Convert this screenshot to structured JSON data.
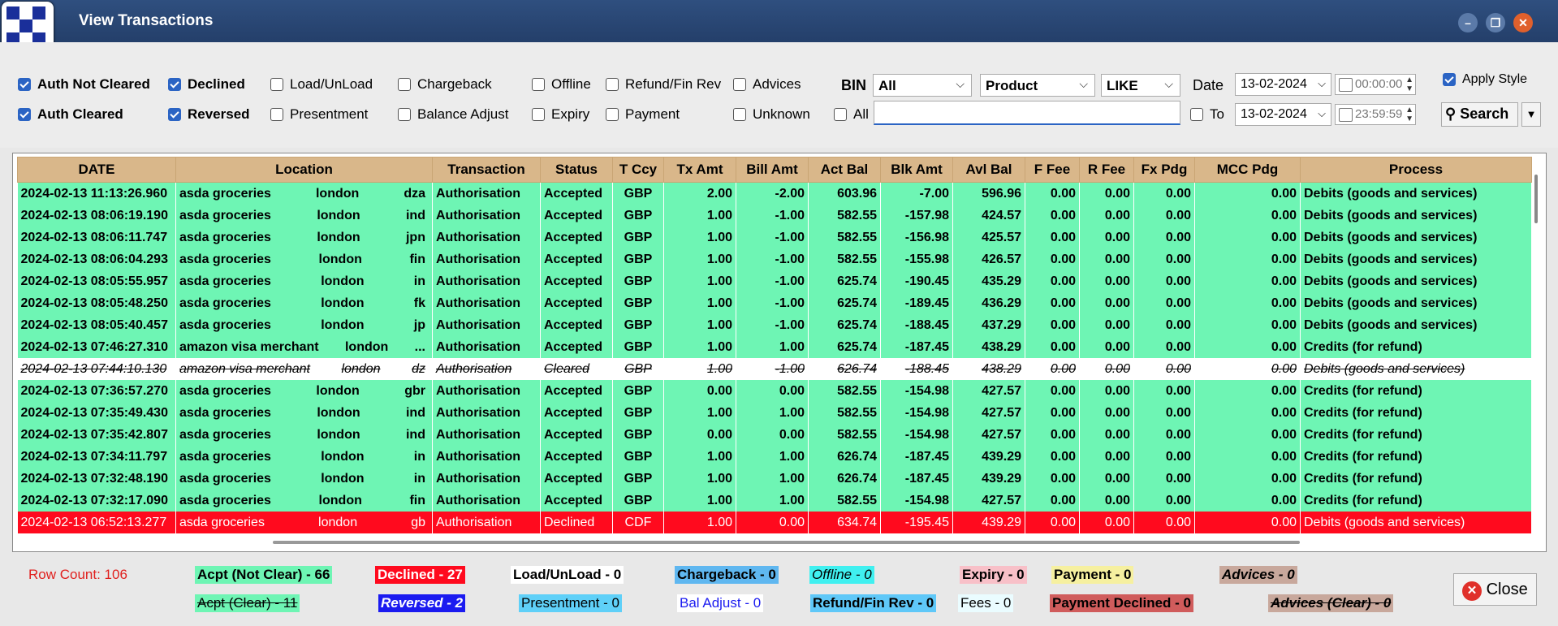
{
  "window": {
    "title": "View Transactions"
  },
  "filters": {
    "checkboxes": [
      {
        "label": "Auth Not Cleared",
        "checked": true
      },
      {
        "label": "Declined",
        "checked": true
      },
      {
        "label": "Load/UnLoad",
        "checked": false
      },
      {
        "label": "Chargeback",
        "checked": false
      },
      {
        "label": "Offline",
        "checked": false
      },
      {
        "label": "Refund/Fin Rev",
        "checked": false
      },
      {
        "label": "Advices",
        "checked": false
      },
      {
        "label": "Auth Cleared",
        "checked": true
      },
      {
        "label": "Reversed",
        "checked": true
      },
      {
        "label": "Presentment",
        "checked": false
      },
      {
        "label": "Balance Adjust",
        "checked": false
      },
      {
        "label": "Expiry",
        "checked": false
      },
      {
        "label": "Payment",
        "checked": false
      },
      {
        "label": "Unknown",
        "checked": false
      },
      {
        "label": "All",
        "checked": false
      },
      {
        "label": "To",
        "checked": false
      },
      {
        "label": "Apply Style",
        "checked": true
      }
    ],
    "bin_label": "BIN",
    "bin_select": "All",
    "product_select": "Product",
    "like_select": "LIKE",
    "date_label": "Date",
    "date_from": "13-02-2024",
    "time_from": "00:00:00",
    "date_to": "13-02-2024",
    "time_to": "23:59:59",
    "search_label": "Search"
  },
  "table": {
    "columns": [
      "DATE",
      "Location",
      "Transaction",
      "Status",
      "T Ccy",
      "Tx Amt",
      "Bill Amt",
      "Act Bal",
      "Blk Amt",
      "Avl Bal",
      "F Fee",
      "R Fee",
      "Fx Pdg",
      "MCC Pdg",
      "Process"
    ],
    "rows": [
      {
        "style": "green",
        "cells": [
          "2024-02-13 11:13:26.960",
          "asda groceries",
          "london",
          "dza",
          "Authorisation",
          "Accepted",
          "GBP",
          "2.00",
          "-2.00",
          "603.96",
          "-7.00",
          "596.96",
          "0.00",
          "0.00",
          "0.00",
          "0.00",
          "Debits (goods and services)"
        ]
      },
      {
        "style": "green",
        "cells": [
          "2024-02-13 08:06:19.190",
          "asda groceries",
          "london",
          "ind",
          "Authorisation",
          "Accepted",
          "GBP",
          "1.00",
          "-1.00",
          "582.55",
          "-157.98",
          "424.57",
          "0.00",
          "0.00",
          "0.00",
          "0.00",
          "Debits (goods and services)"
        ]
      },
      {
        "style": "green",
        "cells": [
          "2024-02-13 08:06:11.747",
          "asda groceries",
          "london",
          "jpn",
          "Authorisation",
          "Accepted",
          "GBP",
          "1.00",
          "-1.00",
          "582.55",
          "-156.98",
          "425.57",
          "0.00",
          "0.00",
          "0.00",
          "0.00",
          "Debits (goods and services)"
        ]
      },
      {
        "style": "green",
        "cells": [
          "2024-02-13 08:06:04.293",
          "asda groceries",
          "london",
          "fin",
          "Authorisation",
          "Accepted",
          "GBP",
          "1.00",
          "-1.00",
          "582.55",
          "-155.98",
          "426.57",
          "0.00",
          "0.00",
          "0.00",
          "0.00",
          "Debits (goods and services)"
        ]
      },
      {
        "style": "green",
        "cells": [
          "2024-02-13 08:05:55.957",
          "asda groceries",
          "london",
          "in",
          "Authorisation",
          "Accepted",
          "GBP",
          "1.00",
          "-1.00",
          "625.74",
          "-190.45",
          "435.29",
          "0.00",
          "0.00",
          "0.00",
          "0.00",
          "Debits (goods and services)"
        ]
      },
      {
        "style": "green",
        "cells": [
          "2024-02-13 08:05:48.250",
          "asda groceries",
          "london",
          "fk",
          "Authorisation",
          "Accepted",
          "GBP",
          "1.00",
          "-1.00",
          "625.74",
          "-189.45",
          "436.29",
          "0.00",
          "0.00",
          "0.00",
          "0.00",
          "Debits (goods and services)"
        ]
      },
      {
        "style": "green",
        "cells": [
          "2024-02-13 08:05:40.457",
          "asda groceries",
          "london",
          "jp",
          "Authorisation",
          "Accepted",
          "GBP",
          "1.00",
          "-1.00",
          "625.74",
          "-188.45",
          "437.29",
          "0.00",
          "0.00",
          "0.00",
          "0.00",
          "Debits (goods and services)"
        ]
      },
      {
        "style": "green",
        "cells": [
          "2024-02-13 07:46:27.310",
          "amazon visa merchant",
          "london",
          "...",
          "Authorisation",
          "Accepted",
          "GBP",
          "1.00",
          "1.00",
          "625.74",
          "-187.45",
          "438.29",
          "0.00",
          "0.00",
          "0.00",
          "0.00",
          "Credits (for refund)"
        ]
      },
      {
        "style": "strike",
        "cells": [
          "2024-02-13 07:44:10.130",
          "amazon visa merchant",
          "london",
          "dz",
          "Authorisation",
          "Cleared",
          "GBP",
          "1.00",
          "-1.00",
          "626.74",
          "-188.45",
          "438.29",
          "0.00",
          "0.00",
          "0.00",
          "0.00",
          "Debits (goods and services)"
        ]
      },
      {
        "style": "green",
        "cells": [
          "2024-02-13 07:36:57.270",
          "asda groceries",
          "london",
          "gbr",
          "Authorisation",
          "Accepted",
          "GBP",
          "0.00",
          "0.00",
          "582.55",
          "-154.98",
          "427.57",
          "0.00",
          "0.00",
          "0.00",
          "0.00",
          "Credits (for refund)"
        ]
      },
      {
        "style": "green",
        "cells": [
          "2024-02-13 07:35:49.430",
          "asda groceries",
          "london",
          "ind",
          "Authorisation",
          "Accepted",
          "GBP",
          "1.00",
          "1.00",
          "582.55",
          "-154.98",
          "427.57",
          "0.00",
          "0.00",
          "0.00",
          "0.00",
          "Credits (for refund)"
        ]
      },
      {
        "style": "green",
        "cells": [
          "2024-02-13 07:35:42.807",
          "asda groceries",
          "london",
          "ind",
          "Authorisation",
          "Accepted",
          "GBP",
          "0.00",
          "0.00",
          "582.55",
          "-154.98",
          "427.57",
          "0.00",
          "0.00",
          "0.00",
          "0.00",
          "Credits (for refund)"
        ]
      },
      {
        "style": "green",
        "cells": [
          "2024-02-13 07:34:11.797",
          "asda groceries",
          "london",
          "in",
          "Authorisation",
          "Accepted",
          "GBP",
          "1.00",
          "1.00",
          "626.74",
          "-187.45",
          "439.29",
          "0.00",
          "0.00",
          "0.00",
          "0.00",
          "Credits (for refund)"
        ]
      },
      {
        "style": "green",
        "cells": [
          "2024-02-13 07:32:48.190",
          "asda groceries",
          "london",
          "in",
          "Authorisation",
          "Accepted",
          "GBP",
          "1.00",
          "1.00",
          "626.74",
          "-187.45",
          "439.29",
          "0.00",
          "0.00",
          "0.00",
          "0.00",
          "Credits (for refund)"
        ]
      },
      {
        "style": "green",
        "cells": [
          "2024-02-13 07:32:17.090",
          "asda groceries",
          "london",
          "fin",
          "Authorisation",
          "Accepted",
          "GBP",
          "1.00",
          "1.00",
          "582.55",
          "-154.98",
          "427.57",
          "0.00",
          "0.00",
          "0.00",
          "0.00",
          "Credits (for refund)"
        ]
      },
      {
        "style": "red",
        "cells": [
          "2024-02-13 06:52:13.277",
          "asda groceries",
          "london",
          "gb",
          "Authorisation",
          "Declined",
          "CDF",
          "1.00",
          "0.00",
          "634.74",
          "-195.45",
          "439.29",
          "0.00",
          "0.00",
          "0.00",
          "0.00",
          "Debits (goods and services)"
        ]
      }
    ]
  },
  "footer": {
    "row_count": "Row Count: 106",
    "legend": [
      {
        "text": "Acpt (Not Clear) - 66",
        "bg": "#6ef5b4",
        "color": "#000",
        "bold": true
      },
      {
        "text": "Declined - 27",
        "bg": "#ff0a1e",
        "color": "#fff",
        "bold": true
      },
      {
        "text": "Load/UnLoad - 0",
        "bg": "#ffffff",
        "color": "#000",
        "bold": true
      },
      {
        "text": "Chargeback - 0",
        "bg": "#5fb7f0",
        "color": "#000",
        "bold": true
      },
      {
        "text": "Offline - 0",
        "bg": "#40f0f0",
        "color": "#000",
        "italic": true
      },
      {
        "text": "Expiry - 0",
        "bg": "#f8c0c8",
        "color": "#000",
        "bold": true
      },
      {
        "text": "Payment - 0",
        "bg": "#f6f0a0",
        "color": "#000",
        "bold": true
      },
      {
        "text": "Advices - 0",
        "bg": "#c8a89c",
        "color": "#000",
        "bold": true,
        "italic": true
      },
      {
        "text": "Acpt (Clear) - 11",
        "bg": "#6ef5b4",
        "color": "#000",
        "strike": true
      },
      {
        "text": "Reversed - 2",
        "bg": "#1b1bf0",
        "color": "#fff",
        "bold": true,
        "italic": true
      },
      {
        "text": "Presentment - 0",
        "bg": "#5fd0f8",
        "color": "#000"
      },
      {
        "text": "Bal Adjust - 0",
        "bg": "#ffffff",
        "color": "#1b1bf0"
      },
      {
        "text": "Refund/Fin Rev - 0",
        "bg": "#5fc8f8",
        "color": "#000",
        "bold": true
      },
      {
        "text": "Fees - 0",
        "bg": "#eafcff",
        "color": "#000"
      },
      {
        "text": "Payment Declined - 0",
        "bg": "#d05c5c",
        "color": "#000",
        "bold": true
      },
      {
        "text": "Advices (Clear) - 0",
        "bg": "#c8a89c",
        "color": "#000",
        "bold": true,
        "italic": true,
        "strike": true
      }
    ],
    "close_label": "Close"
  }
}
